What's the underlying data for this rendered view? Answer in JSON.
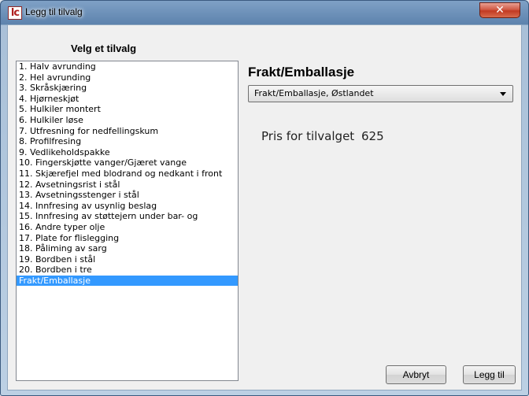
{
  "window": {
    "app_icon_text": "lc",
    "title": "Legg til tilvalg",
    "close_glyph": "✕"
  },
  "options_panel": {
    "heading": "Velg et tilvalg",
    "items": [
      "1. Halv avrunding",
      "2. Hel avrunding",
      "3. Skråskjæring",
      "4. Hjørneskjøt",
      "5. Hulkiler montert",
      "6. Hulkiler løse",
      "7. Utfresning for nedfellingskum",
      "8. Profilfresing",
      "9. Vedlikeholdspakke",
      "10. Fingerskjøtte vanger/Gjæret vange",
      "11. Skjærefjel med blodrand og nedkant i front",
      "12. Avsetningsrist i stål",
      "13. Avsetningsstenger i stål",
      "14. Innfresing av usynlig beslag",
      "15. Innfresing av støttejern under bar- og",
      "16. Andre typer olje",
      "17. Plate for flislegging",
      "18. Påliming av sarg",
      "19. Bordben i stål",
      "20. Bordben i tre",
      "Frakt/Emballasje"
    ],
    "selected_index": 20
  },
  "detail": {
    "title": "Frakt/Emballasje",
    "dropdown_value": "Frakt/Emballasje, Østlandet",
    "price_label": "Pris for tilvalget",
    "price_value": "625"
  },
  "buttons": {
    "cancel": "Avbryt",
    "add": "Legg til"
  },
  "colors": {
    "selection": "#3399ff",
    "close_button": "#c23a22",
    "titlebar": "#5d83ad"
  }
}
